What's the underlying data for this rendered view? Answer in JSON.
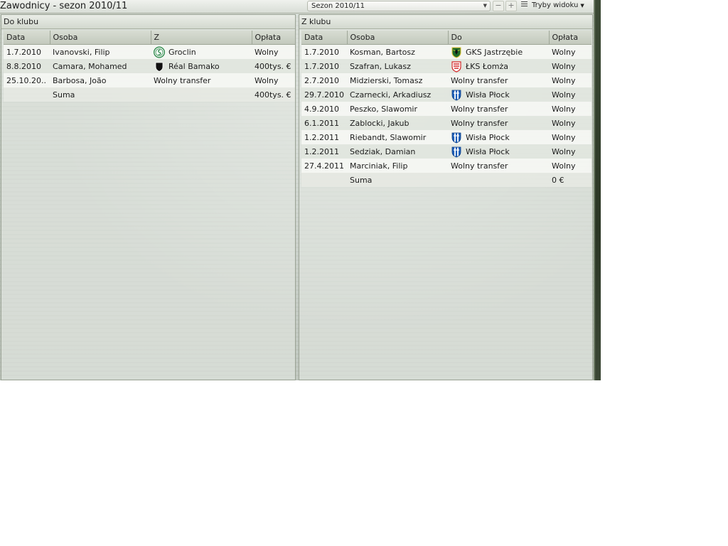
{
  "title": "Zawodnicy - sezon 2010/11",
  "season_select": {
    "value": "Sezon 2010/11"
  },
  "toolbar": {
    "minus_label": "−",
    "plus_label": "+",
    "view_modes_label": "Tryby widoku"
  },
  "left_panel": {
    "title": "Do klubu",
    "columns": [
      "Data",
      "Osoba",
      "Z",
      "Opłata"
    ],
    "rows": [
      {
        "date": "1.7.2010",
        "person": "Ivanovski, Filip",
        "club": "Groclin",
        "crest": "groclin-crest-icon",
        "fee": "Wolny"
      },
      {
        "date": "8.8.2010",
        "person": "Camara, Mohamed",
        "club": "Réal Bamako",
        "crest": "real-bamako-crest-icon",
        "fee": "400tys. €"
      },
      {
        "date": "25.10.20..",
        "person": "Barbosa, João",
        "club": "Wolny transfer",
        "crest": "",
        "fee": "Wolny"
      }
    ],
    "sum": {
      "label": "Suma",
      "value": "400tys. €"
    }
  },
  "right_panel": {
    "title": "Z klubu",
    "columns": [
      "Data",
      "Osoba",
      "Do",
      "Opłata"
    ],
    "rows": [
      {
        "date": "1.7.2010",
        "person": "Kosman, Bartosz",
        "club": "GKS Jastrzębie",
        "crest": "gks-jastrzebie-crest-icon",
        "fee": "Wolny"
      },
      {
        "date": "1.7.2010",
        "person": "Szafran, Lukasz",
        "club": "ŁKS Łomża",
        "crest": "lks-lomza-crest-icon",
        "fee": "Wolny"
      },
      {
        "date": "2.7.2010",
        "person": "Midzierski, Tomasz",
        "club": "Wolny transfer",
        "crest": "",
        "fee": "Wolny"
      },
      {
        "date": "29.7.2010",
        "person": "Czarnecki, Arkadiusz",
        "club": "Wisła Płock",
        "crest": "wisla-plock-crest-icon",
        "fee": "Wolny"
      },
      {
        "date": "4.9.2010",
        "person": "Peszko, Slawomir",
        "club": "Wolny transfer",
        "crest": "",
        "fee": "Wolny"
      },
      {
        "date": "6.1.2011",
        "person": "Zablocki, Jakub",
        "club": "Wolny transfer",
        "crest": "",
        "fee": "Wolny"
      },
      {
        "date": "1.2.2011",
        "person": "Riebandt, Slawomir",
        "club": "Wisła Płock",
        "crest": "wisla-plock-crest-icon",
        "fee": "Wolny"
      },
      {
        "date": "1.2.2011",
        "person": "Sedziak, Damian",
        "club": "Wisła Płock",
        "crest": "wisla-plock-crest-icon",
        "fee": "Wolny"
      },
      {
        "date": "27.4.2011",
        "person": "Marciniak, Filip",
        "club": "Wolny transfer",
        "crest": "",
        "fee": "Wolny"
      }
    ],
    "sum": {
      "label": "Suma",
      "value": "0 €"
    }
  }
}
